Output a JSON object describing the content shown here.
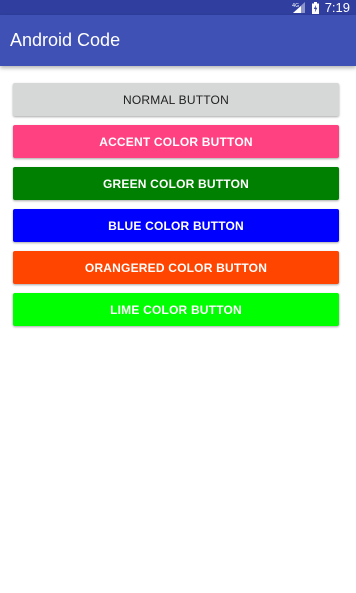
{
  "status_bar": {
    "time": "7:19",
    "signal_icon": "signal-4g-icon",
    "battery_icon": "battery-charging-icon",
    "color": "#303f9f"
  },
  "app_bar": {
    "title": "Android Code",
    "color": "#3f51b5"
  },
  "buttons": [
    {
      "label": "NORMAL BUTTON",
      "color": "#d6d7d7"
    },
    {
      "label": "ACCENT COLOR BUTTON",
      "color": "#ff4081"
    },
    {
      "label": "GREEN COLOR BUTTON",
      "color": "#008000"
    },
    {
      "label": "BLUE COLOR BUTTON",
      "color": "#0000ff"
    },
    {
      "label": "ORANGERED COLOR BUTTON",
      "color": "#ff4500"
    },
    {
      "label": "LIME COLOR BUTTON",
      "color": "#00ff00"
    }
  ]
}
